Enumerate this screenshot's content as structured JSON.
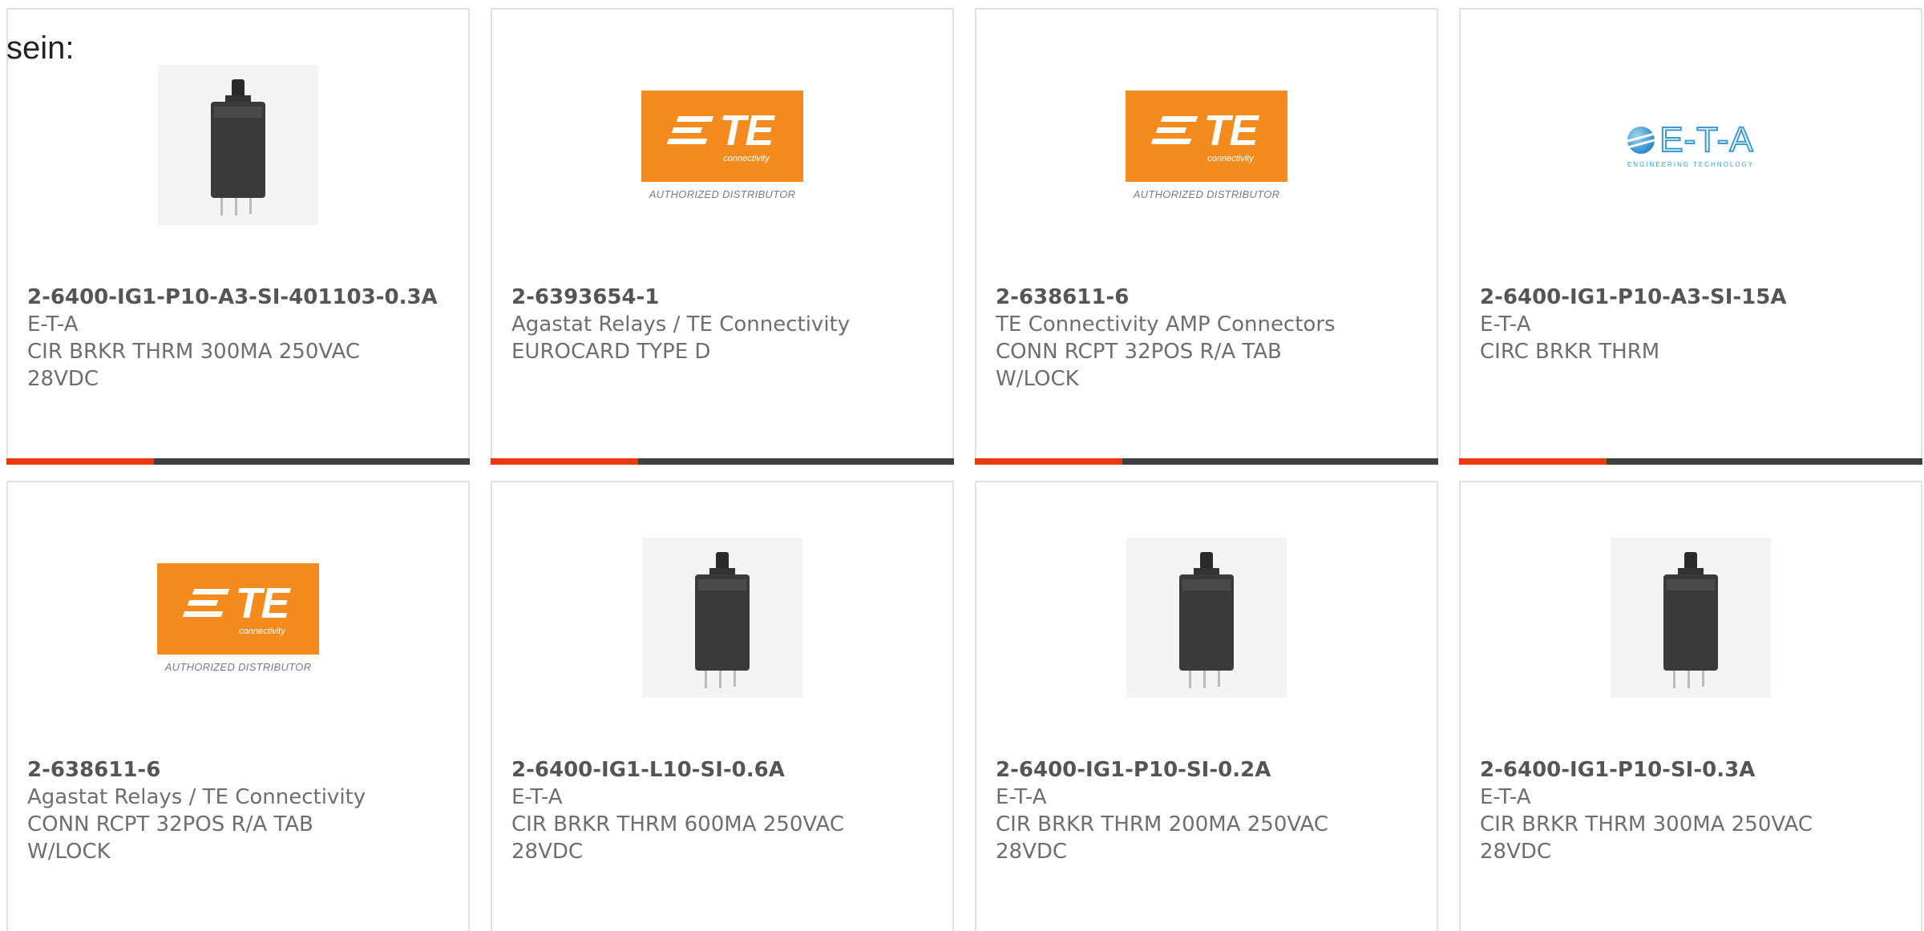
{
  "heading": "sein:",
  "logos": {
    "te": {
      "letters": "TE",
      "sub": "connectivity",
      "authorized": "AUTHORIZED DISTRIBUTOR"
    },
    "eta": {
      "letters": "E-T-A",
      "sub": "ENGINEERING TECHNOLOGY"
    }
  },
  "colors": {
    "accent_bar": "#e8380d",
    "bar_rest": "#3f3f3f",
    "te_orange": "#f58b1f",
    "eta_blue": "#3a9ad6"
  },
  "products": [
    {
      "image": "circuit-breaker-photo",
      "part_number": "2-6400-IG1-P10-A3-SI-401103-0.3A",
      "manufacturer": "E-T-A",
      "description": "CIR BRKR THRM 300MA 250VAC 28VDC"
    },
    {
      "image": "te-connectivity-logo",
      "part_number": "2-6393654-1",
      "manufacturer": "Agastat Relays / TE Connectivity",
      "description": "EUROCARD TYPE D"
    },
    {
      "image": "te-connectivity-logo",
      "part_number": "2-638611-6",
      "manufacturer": "TE Connectivity AMP Connectors",
      "description": "CONN RCPT 32POS R/A TAB W/LOCK"
    },
    {
      "image": "eta-logo",
      "part_number": "2-6400-IG1-P10-A3-SI-15A",
      "manufacturer": "E-T-A",
      "description": "CIRC BRKR THRM"
    },
    {
      "image": "te-connectivity-logo",
      "part_number": "2-638611-6",
      "manufacturer": "Agastat Relays / TE Connectivity",
      "description": "CONN RCPT 32POS R/A TAB W/LOCK"
    },
    {
      "image": "circuit-breaker-photo",
      "part_number": "2-6400-IG1-L10-SI-0.6A",
      "manufacturer": "E-T-A",
      "description": "CIR BRKR THRM 600MA 250VAC 28VDC"
    },
    {
      "image": "circuit-breaker-photo",
      "part_number": "2-6400-IG1-P10-SI-0.2A",
      "manufacturer": "E-T-A",
      "description": "CIR BRKR THRM 200MA 250VAC 28VDC"
    },
    {
      "image": "circuit-breaker-photo",
      "part_number": "2-6400-IG1-P10-SI-0.3A",
      "manufacturer": "E-T-A",
      "description": "CIR BRKR THRM 300MA 250VAC 28VDC"
    }
  ]
}
